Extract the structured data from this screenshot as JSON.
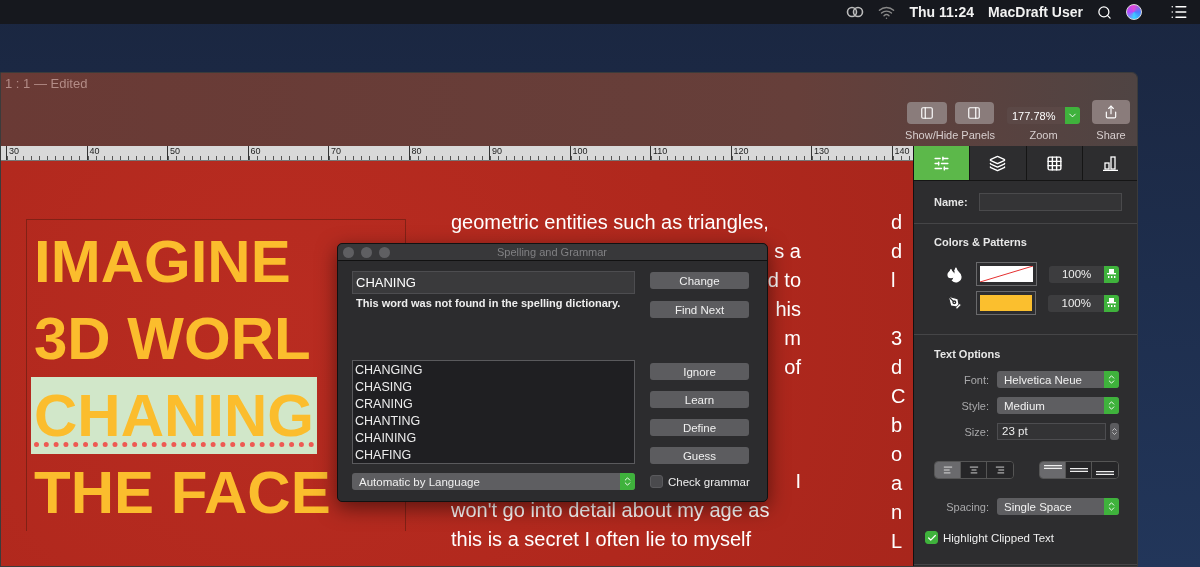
{
  "menu_bar": {
    "clock": "Thu 11:24",
    "user": "MacDraft User"
  },
  "window": {
    "title": "1 : 1 — Edited",
    "toolbar": {
      "panels_label": "Show/Hide Panels",
      "zoom_value": "177.78%",
      "zoom_label": "Zoom",
      "share_label": "Share"
    }
  },
  "ruler": {
    "labels": [
      "30",
      "40",
      "50",
      "60",
      "70",
      "80",
      "90",
      "100",
      "110",
      "120",
      "130",
      "140"
    ]
  },
  "canvas": {
    "headline": [
      {
        "text": "IMAGINE",
        "misspelled": false
      },
      {
        "text": "3D WORL",
        "misspelled": false
      },
      {
        "text": "CHANING",
        "misspelled": true
      },
      {
        "text": "THE FACE",
        "misspelled": false
      }
    ],
    "column_2": {
      "upper": [
        {
          "text": "geometric entities such as triangles,",
          "kind": "full"
        },
        {
          "text": "s a",
          "kind": "tail"
        },
        {
          "text": "d to",
          "kind": "tail"
        },
        {
          "text": "his",
          "kind": "tail"
        },
        {
          "text": "m",
          "kind": "tail"
        },
        {
          "text": "of",
          "kind": "tail"
        }
      ],
      "lower": [
        {
          "text": "I",
          "kind": "tail"
        },
        {
          "text": "won't go into detail about my age as",
          "kind": "full"
        },
        {
          "text": "this is a secret I often lie to myself",
          "kind": "full"
        }
      ]
    },
    "column_3": {
      "paragraphs": [
        [
          "d",
          "d",
          "l"
        ],
        [
          "3",
          "d",
          "C",
          "b",
          "o",
          "a",
          "n",
          "L"
        ]
      ]
    }
  },
  "spelling_dialog": {
    "title": "Spelling and Grammar",
    "word": "CHANING",
    "message": "This word was not found in the spelling dictionary.",
    "top_buttons": [
      "Change",
      "Find Next"
    ],
    "suggestions": [
      "CHANGING",
      "CHASING",
      "CRANING",
      "CHANTING",
      "CHAINING",
      "CHAFING"
    ],
    "bottom_buttons": [
      "Ignore",
      "Learn",
      "Define",
      "Guess"
    ],
    "language": "Automatic by Language",
    "check_grammar": {
      "label": "Check grammar",
      "checked": false
    }
  },
  "inspector": {
    "tabs": [
      {
        "kind": "properties",
        "selected": true
      },
      {
        "kind": "layers",
        "selected": false
      },
      {
        "kind": "table",
        "selected": false
      },
      {
        "kind": "chart",
        "selected": false
      }
    ],
    "name_label": "Name:",
    "colors": {
      "heading": "Colors & Patterns",
      "rows": [
        {
          "kind": "fill",
          "no_color": true,
          "opacity": "100%"
        },
        {
          "kind": "stroke",
          "no_color": false,
          "color": "#fbbf2e",
          "opacity": "100%"
        }
      ]
    },
    "text_options": {
      "heading": "Text Options",
      "font": {
        "label": "Font:",
        "value": "Helvetica Neue"
      },
      "style": {
        "label": "Style:",
        "value": "Medium"
      },
      "size": {
        "label": "Size:",
        "value": "23 pt"
      },
      "align": [
        {
          "kind": "left",
          "selected": true
        },
        {
          "kind": "center",
          "selected": false
        },
        {
          "kind": "right",
          "selected": false
        }
      ],
      "valign": [
        {
          "kind": "top",
          "selected": true
        },
        {
          "kind": "middle",
          "selected": false
        },
        {
          "kind": "bottom",
          "selected": false
        }
      ],
      "spacing": {
        "label": "Spacing:",
        "value": "Single Space"
      },
      "highlight_clipped": {
        "label": "Highlight Clipped Text",
        "checked": true
      }
    }
  }
}
